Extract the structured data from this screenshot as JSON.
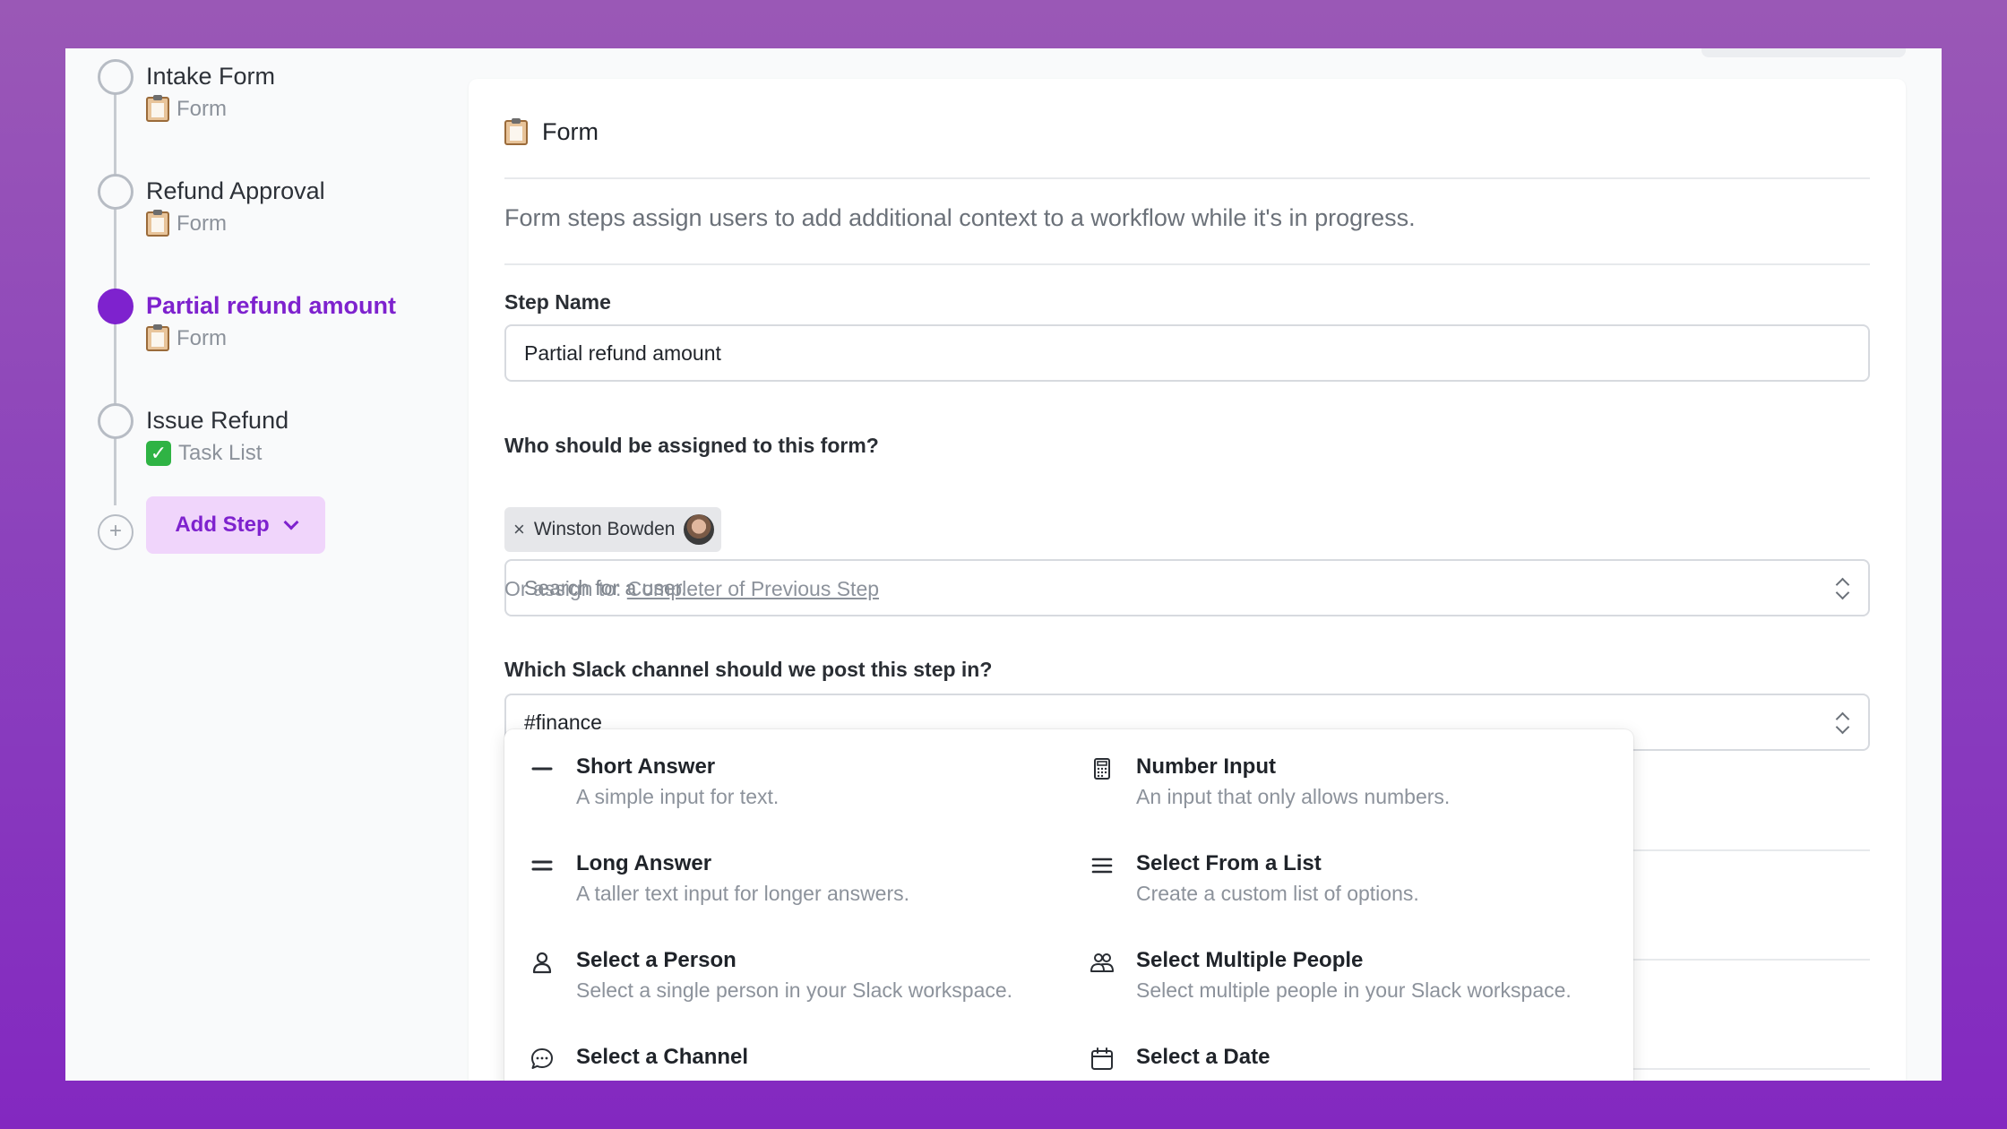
{
  "sidebar": {
    "steps": [
      {
        "title": "Intake Form",
        "type": "Form",
        "icon": "clipboard-icon",
        "active": false
      },
      {
        "title": "Refund Approval",
        "type": "Form",
        "icon": "clipboard-icon",
        "active": false
      },
      {
        "title": "Partial refund amount",
        "type": "Form",
        "icon": "clipboard-icon",
        "active": true
      },
      {
        "title": "Issue Refund",
        "type": "Task List",
        "icon": "check-mark-icon",
        "active": false
      }
    ],
    "add_step_label": "Add Step"
  },
  "panel": {
    "header": "Form",
    "description": "Form steps assign users to add additional context to a workflow while it's in progress.",
    "step_name": {
      "label": "Step Name",
      "value": "Partial refund amount"
    },
    "assignee": {
      "label": "Who should be assigned to this form?",
      "chip_name": "Winston Bowden",
      "chip_remove": "×",
      "search_placeholder": "Search for a user...",
      "hint_prefix": "Or assign to:",
      "hint_link": "Completer of Previous Step"
    },
    "slack": {
      "label": "Which Slack channel should we post this step in?",
      "value": "#finance"
    }
  },
  "menu": {
    "items": [
      {
        "title": "Short Answer",
        "desc": "A simple input for text.",
        "icon": "dash-icon"
      },
      {
        "title": "Number Input",
        "desc": "An input that only allows numbers.",
        "icon": "calculator-icon"
      },
      {
        "title": "Long Answer",
        "desc": "A taller text input for longer answers.",
        "icon": "double-line-icon"
      },
      {
        "title": "Select From a List",
        "desc": "Create a custom list of options.",
        "icon": "list-icon"
      },
      {
        "title": "Select a Person",
        "desc": "Select a single person in your Slack workspace.",
        "icon": "person-icon"
      },
      {
        "title": "Select Multiple People",
        "desc": "Select multiple people in your Slack workspace.",
        "icon": "people-icon"
      },
      {
        "title": "Select a Channel",
        "desc": "",
        "icon": "chat-bubble-icon"
      },
      {
        "title": "Select a Date",
        "desc": "",
        "icon": "calendar-icon"
      }
    ]
  },
  "colors": {
    "accent": "#7e22ce",
    "accent_light": "#f0d5fb",
    "background_gradient_top": "#9a58b6",
    "background_gradient_bottom": "#8328c0"
  }
}
